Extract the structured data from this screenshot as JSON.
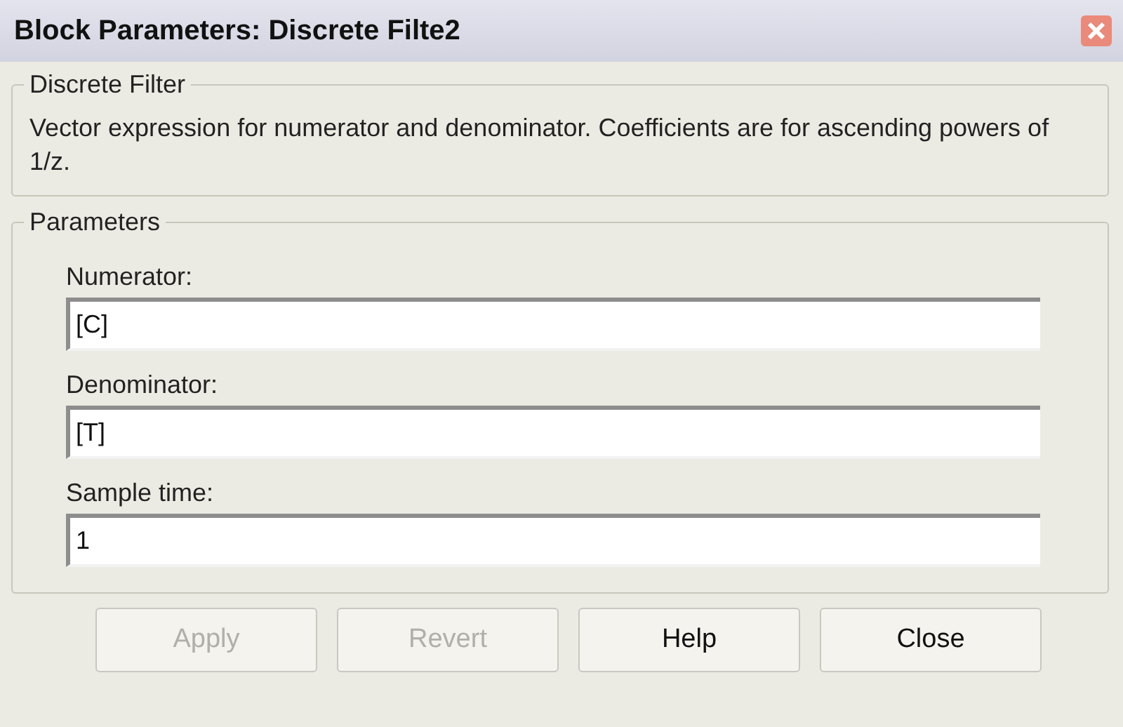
{
  "window": {
    "title": "Block Parameters: Discrete Filte2"
  },
  "description_group": {
    "title": "Discrete Filter",
    "text": "Vector expression for numerator and denominator.  Coefficients are for ascending powers of 1/z."
  },
  "parameters_group": {
    "title": "Parameters",
    "fields": [
      {
        "label": "Numerator:",
        "value": "[C]"
      },
      {
        "label": "Denominator:",
        "value": "[T]"
      },
      {
        "label": "Sample time:",
        "value": "1"
      }
    ]
  },
  "buttons": [
    {
      "label": "Apply",
      "disabled": true
    },
    {
      "label": "Revert",
      "disabled": true
    },
    {
      "label": "Help",
      "disabled": false
    },
    {
      "label": "Close",
      "disabled": false
    }
  ]
}
